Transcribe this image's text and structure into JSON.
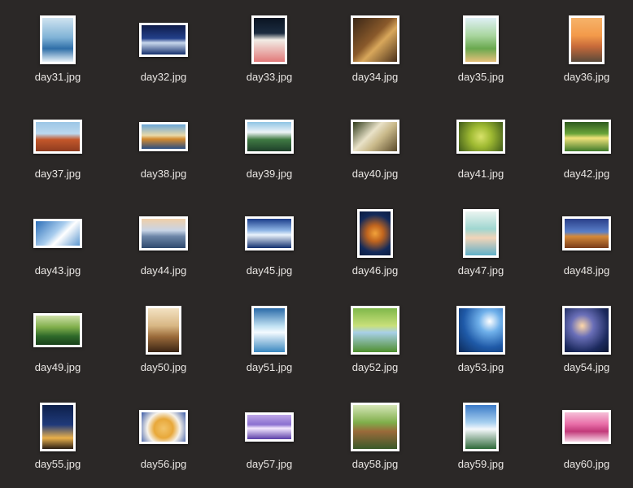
{
  "files": [
    {
      "name": "day31.jpg",
      "shape": "port",
      "bg": "linear-gradient(180deg,#cfe3f0 0%,#7fb2d6 45%,#2f6fa8 70%,#e8f2f8 100%)"
    },
    {
      "name": "day32.jpg",
      "shape": "land",
      "bg": "linear-gradient(180deg,#0f1c4a 0%,#23408a 45%,#c8d7ec 60%,#16306e 100%)"
    },
    {
      "name": "day33.jpg",
      "shape": "port",
      "bg": "linear-gradient(180deg,#0a1422 0%,#1b2c40 35%,#f2ede6 50%,#e27a7a 100%)"
    },
    {
      "name": "day34.jpg",
      "shape": "sq",
      "bg": "linear-gradient(135deg,#3a2616 0%,#8a5a2b 45%,#d8a75b 60%,#4a301a 100%)"
    },
    {
      "name": "day35.jpg",
      "shape": "port",
      "bg": "linear-gradient(180deg,#dff0f6 0%,#a9d6a0 40%,#6aa84f 70%,#e6c07a 100%)"
    },
    {
      "name": "day36.jpg",
      "shape": "port",
      "bg": "linear-gradient(180deg,#f6b36a 0%,#f39a4a 40%,#c76a3a 65%,#5a4a3a 100%)"
    },
    {
      "name": "day37.jpg",
      "shape": "land",
      "bg": "linear-gradient(180deg,#9cc6e6 0%,#bcd8ee 40%,#c4572b 60%,#8e3b1f 100%)"
    },
    {
      "name": "day38.jpg",
      "shape": "wide",
      "bg": "linear-gradient(180deg,#6aa6d8 0%,#e9d9a8 45%,#d38a2f 60%,#2a4f84 100%)"
    },
    {
      "name": "day39.jpg",
      "shape": "land",
      "bg": "linear-gradient(180deg,#8fc4e4 0%,#eef4f8 35%,#3f7a43 60%,#1e3f2a 100%)"
    },
    {
      "name": "day40.jpg",
      "shape": "land",
      "bg": "linear-gradient(135deg,#2f3a1a 0%,#e9e2c8 40%,#c9b98a 60%,#5a4a2a 100%)"
    },
    {
      "name": "day41.jpg",
      "shape": "land",
      "bg": "radial-gradient(circle at 50% 50%,#d8e26a 0%,#9fba32 40%,#3f5a1a 100%)"
    },
    {
      "name": "day42.jpg",
      "shape": "land",
      "bg": "linear-gradient(180deg,#2e5a1e 0%,#6aa43a 40%,#f0e27a 55%,#3d7a2a 100%)"
    },
    {
      "name": "day43.jpg",
      "shape": "wide",
      "bg": "linear-gradient(135deg,#2d6fb8 0%,#a9cdee 45%,#ffffff 60%,#5b97d0 100%)"
    },
    {
      "name": "day44.jpg",
      "shape": "land",
      "bg": "linear-gradient(180deg,#f0cfa8 0%,#c8d4e6 40%,#6d86a8 60%,#2f4a6e 100%)"
    },
    {
      "name": "day45.jpg",
      "shape": "land",
      "bg": "linear-gradient(180deg,#1a3c8a 0%,#8fb6e6 40%,#eaf3fb 55%,#123070 100%)"
    },
    {
      "name": "day46.jpg",
      "shape": "port",
      "bg": "radial-gradient(circle at 50% 50%,#f2a23a 0%,#c0641e 30%,#132a5a 70%,#0b1c40 100%)"
    },
    {
      "name": "day47.jpg",
      "shape": "port",
      "bg": "linear-gradient(180deg,#eaf4f0 0%,#9fd6d0 40%,#f2d4b8 60%,#5fb0c8 100%)"
    },
    {
      "name": "day48.jpg",
      "shape": "land",
      "bg": "linear-gradient(180deg,#2a3f8a 0%,#5a7fc8 45%,#d58a3a 60%,#7a3c1a 100%)"
    },
    {
      "name": "day49.jpg",
      "shape": "land",
      "bg": "linear-gradient(180deg,#cfe0a8 0%,#7fae4a 40%,#2f6a2a 70%,#18401a 100%)"
    },
    {
      "name": "day50.jpg",
      "shape": "port",
      "bg": "linear-gradient(180deg,#f3e2c2 0%,#d8b784 40%,#9a6a3a 65%,#3a2414 100%)"
    },
    {
      "name": "day51.jpg",
      "shape": "port",
      "bg": "linear-gradient(180deg,#2a6aa8 0%,#bfe0f2 40%,#f4fbff 55%,#3a88c0 100%)"
    },
    {
      "name": "day52.jpg",
      "shape": "sq",
      "bg": "linear-gradient(180deg,#7fb84a 0%,#c9e07a 40%,#a8d0e8 55%,#4f8f2f 100%)"
    },
    {
      "name": "day53.jpg",
      "shape": "sq",
      "bg": "radial-gradient(circle at 70% 30%,#ffffff 0%,#6fb0ea 25%,#1f5aa8 60%,#0c2a5a 100%)"
    },
    {
      "name": "day54.jpg",
      "shape": "sq",
      "bg": "radial-gradient(circle at 40% 40%,#ffd8a8 0%,#6a6fb8 30%,#1c2a5e 70%,#0a1430 100%)"
    },
    {
      "name": "day55.jpg",
      "shape": "port",
      "bg": "linear-gradient(180deg,#0d1f4a 0%,#1f3a7a 45%,#e9b04a 75%,#2a1e14 100%)"
    },
    {
      "name": "day56.jpg",
      "shape": "land",
      "bg": "radial-gradient(circle at 50% 55%,#f2c46a 0%,#e8a83a 35%,#f6f2ea 60%,#3a5aa8 100%)"
    },
    {
      "name": "day57.jpg",
      "shape": "wide",
      "bg": "linear-gradient(180deg,#bfa8e8 0%,#8a6fd0 40%,#f4e8ff 55%,#5a3ea8 100%)"
    },
    {
      "name": "day58.jpg",
      "shape": "sq",
      "bg": "linear-gradient(180deg,#d6e6b8 0%,#7fae4a 40%,#9a6a3a 60%,#3a5a2a 100%)"
    },
    {
      "name": "day59.jpg",
      "shape": "port",
      "bg": "linear-gradient(180deg,#3a7ac8 0%,#a8d0f0 40%,#f4f8fb 55%,#2f6a3a 100%)"
    },
    {
      "name": "day60.jpg",
      "shape": "land",
      "bg": "linear-gradient(180deg,#f6c0d8 0%,#e86ea8 40%,#c23a7a 65%,#f8d6e6 100%)"
    }
  ]
}
